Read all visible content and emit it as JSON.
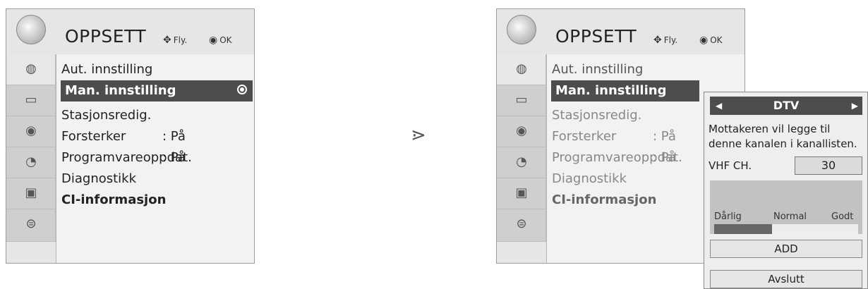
{
  "left_menu": {
    "title": "OPPSETT",
    "hint_move": "Fly.",
    "hint_ok": "OK",
    "items": [
      {
        "label": "Aut. innstilling",
        "value": ""
      },
      {
        "label": "Man. innstilling",
        "value": ""
      },
      {
        "label": "Stasjonsredig.",
        "value": ""
      },
      {
        "label": "Forsterker",
        "value": ": På"
      },
      {
        "label": "Programvareoppdat.",
        "value": ": På"
      },
      {
        "label": "Diagnostikk",
        "value": ""
      },
      {
        "label": "CI-informasjon",
        "value": ""
      }
    ]
  },
  "arrow": "⋗",
  "right_menu": {
    "title": "OPPSETT",
    "hint_move": "Fly.",
    "hint_ok": "OK",
    "items": [
      {
        "label": "Aut. innstilling",
        "value": ""
      },
      {
        "label": "Man. innstilling",
        "value": ""
      },
      {
        "label": "Stasjonsredig.",
        "value": ""
      },
      {
        "label": "Forsterker",
        "value": ": På"
      },
      {
        "label": "Programvareoppdat.",
        "value": ": På"
      },
      {
        "label": "Diagnostikk",
        "value": ""
      },
      {
        "label": "CI-informasjon",
        "value": ""
      }
    ]
  },
  "popup": {
    "mode": "DTV",
    "message": "Mottakeren vil legge til denne kanalen i kanallisten.",
    "channel_label": "VHF CH.",
    "channel_value": "30",
    "signal_labels": [
      "Dårlig",
      "Normal",
      "Godt"
    ],
    "signal_level": 0.4,
    "add_label": "ADD",
    "exit_label": "Avslutt"
  },
  "icons": [
    "setup-icon",
    "tv-icon",
    "speaker-icon",
    "clock-icon",
    "options-icon",
    "lock-icon"
  ]
}
